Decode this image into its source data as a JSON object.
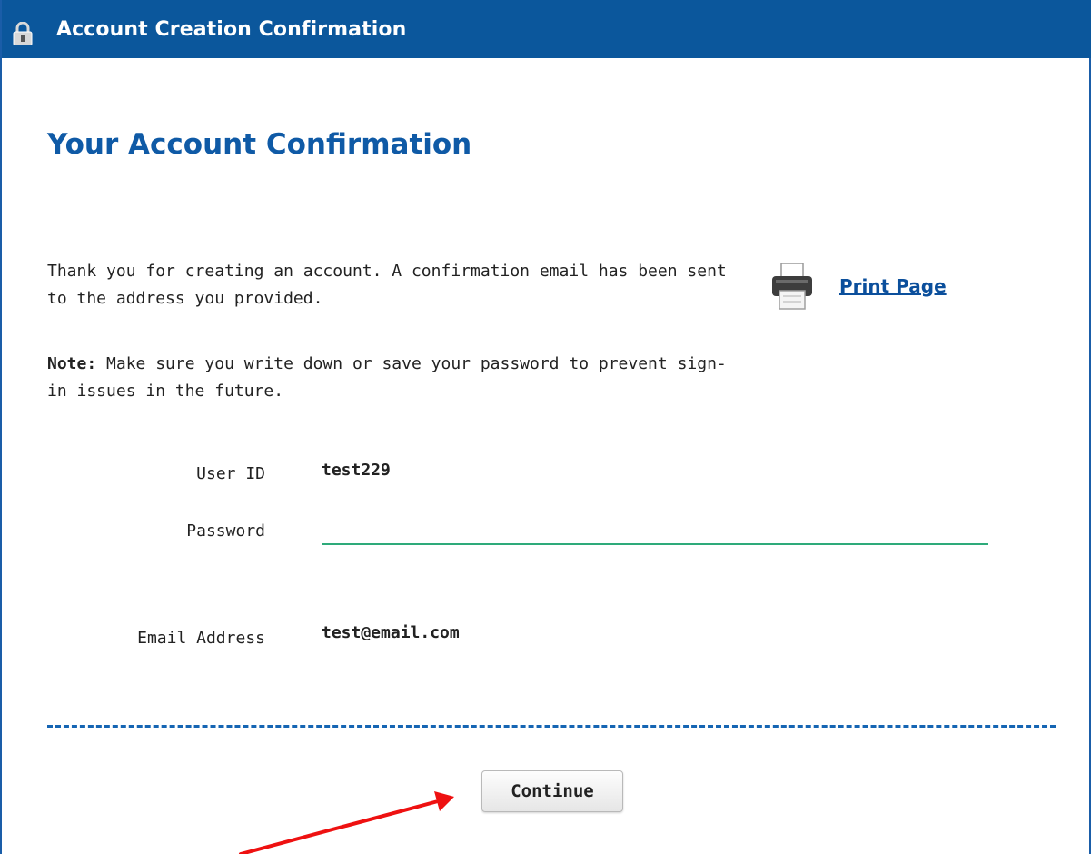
{
  "window": {
    "title": "Account Creation Confirmation",
    "accent_color": "#0b579c"
  },
  "page": {
    "title": "Your Account Confirmation",
    "thanks_message": "Thank you for creating an account. A confirmation email has been sent to the address you provided.",
    "note_label": "Note:",
    "note_message": " Make sure you write down or save your password to prevent sign-in issues in the future.",
    "print_label": "Print Page"
  },
  "fields": {
    "user_id": {
      "label": "User ID",
      "value": "test229"
    },
    "password": {
      "label": "Password",
      "value": ""
    },
    "email": {
      "label": "Email Address",
      "value": "test@email.com"
    }
  },
  "actions": {
    "continue_label": "Continue"
  },
  "icons": {
    "title": "lock-icon",
    "print": "printer-icon"
  },
  "annotation": {
    "arrow_color": "#ee1111"
  }
}
